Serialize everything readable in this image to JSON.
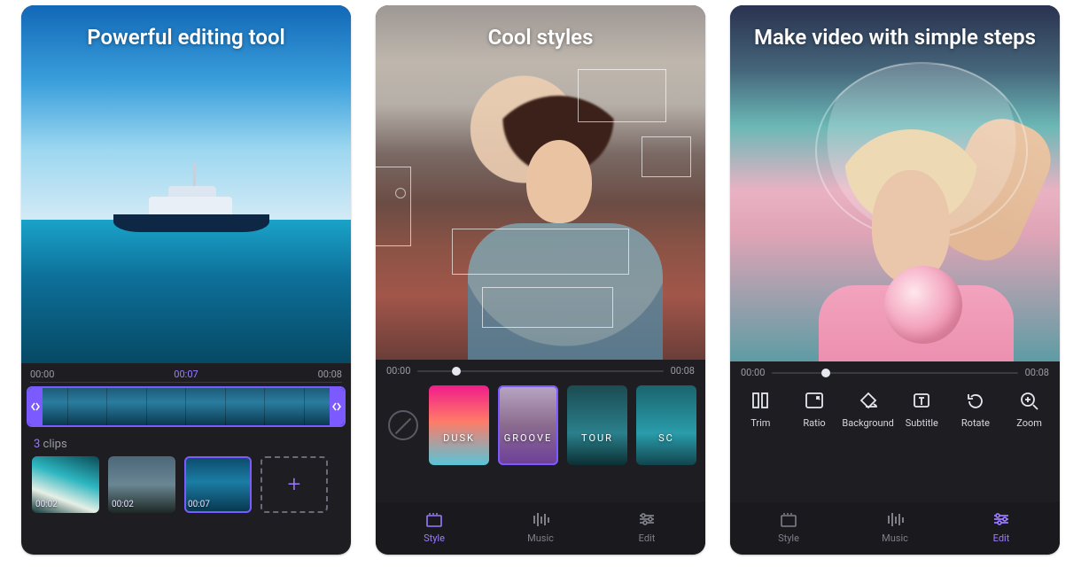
{
  "colors": {
    "accent": "#7b5bff",
    "text_dim": "#9a9aa5"
  },
  "phone1": {
    "title": "Powerful editing tool",
    "time_start": "00:00",
    "time_mid": "00:07",
    "time_end": "00:08",
    "clips_count_prefix": "3",
    "clips_label": " clips",
    "clips": [
      {
        "duration": "00:02"
      },
      {
        "duration": "00:02"
      },
      {
        "duration": "00:07"
      }
    ],
    "add_label": "+"
  },
  "phone2": {
    "title": "Cool styles",
    "time_start": "00:00",
    "time_end": "00:08",
    "styles": [
      {
        "label": "DUSK"
      },
      {
        "label": "GROOVE"
      },
      {
        "label": "TOUR"
      },
      {
        "label": "SC"
      }
    ],
    "tabs": {
      "style": "Style",
      "music": "Music",
      "edit": "Edit"
    }
  },
  "phone3": {
    "title": "Make video with simple steps",
    "time_start": "00:00",
    "time_end": "00:08",
    "tools": {
      "trim": "Trim",
      "ratio": "Ratio",
      "background": "Background",
      "subtitle": "Subtitle",
      "rotate": "Rotate",
      "zoom": "Zoom"
    },
    "tabs": {
      "style": "Style",
      "music": "Music",
      "edit": "Edit"
    }
  }
}
